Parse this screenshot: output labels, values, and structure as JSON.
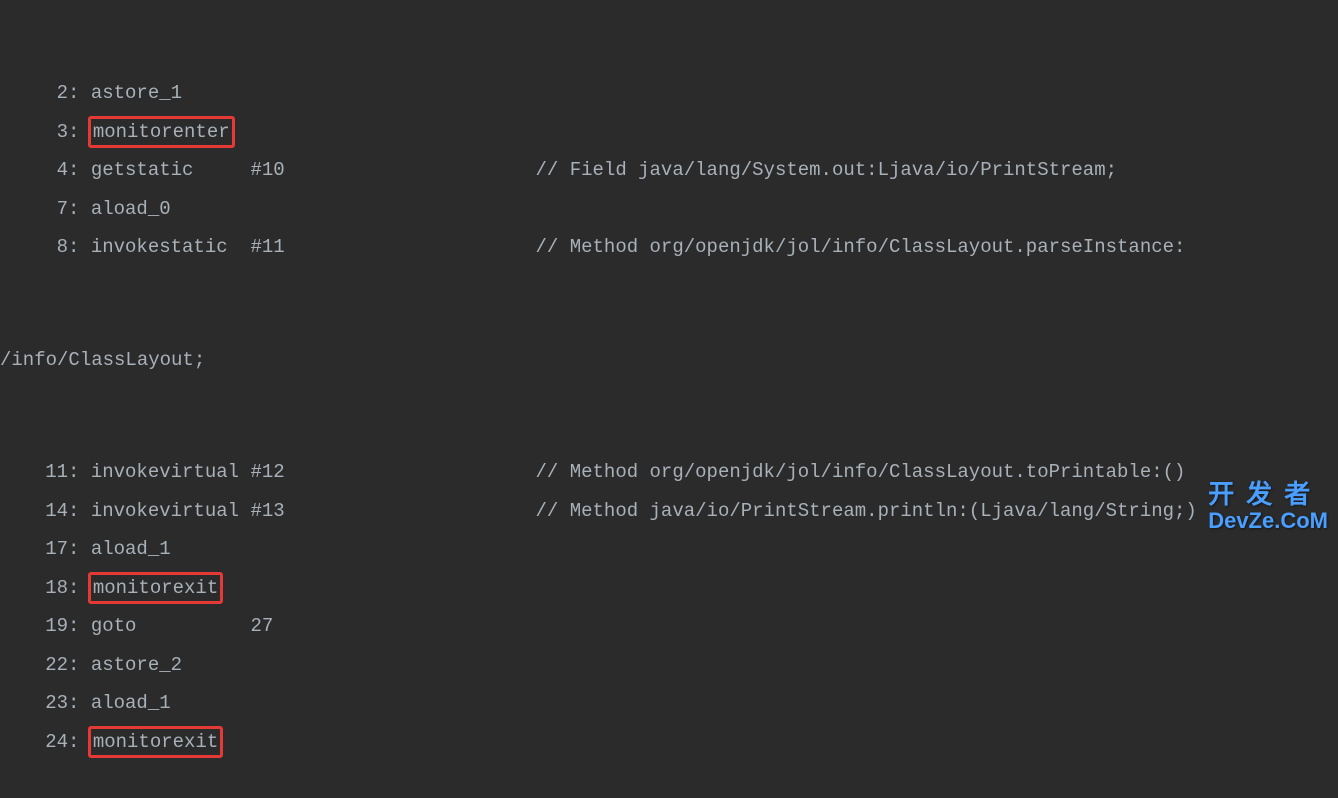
{
  "lines": [
    {
      "num": "2",
      "inst": "astore_1",
      "arg": "",
      "comment": "",
      "highlighted": false
    },
    {
      "num": "3",
      "inst": "monitorenter",
      "arg": "",
      "comment": "",
      "highlighted": true
    },
    {
      "num": "4",
      "inst": "getstatic",
      "arg": "#10",
      "comment": "// Field java/lang/System.out:Ljava/io/PrintStream;",
      "highlighted": false
    },
    {
      "num": "7",
      "inst": "aload_0",
      "arg": "",
      "comment": "",
      "highlighted": false
    },
    {
      "num": "8",
      "inst": "invokestatic",
      "arg": "#11",
      "comment": "// Method org/openjdk/jol/info/ClassLayout.parseInstance:",
      "highlighted": false
    }
  ],
  "continuation_line": "/info/ClassLayout;",
  "lines2": [
    {
      "num": "11",
      "inst": "invokevirtual",
      "arg": "#12",
      "comment": "// Method org/openjdk/jol/info/ClassLayout.toPrintable:()",
      "highlighted": false
    },
    {
      "num": "14",
      "inst": "invokevirtual",
      "arg": "#13",
      "comment": "// Method java/io/PrintStream.println:(Ljava/lang/String;)",
      "highlighted": false
    },
    {
      "num": "17",
      "inst": "aload_1",
      "arg": "",
      "comment": "",
      "highlighted": false
    },
    {
      "num": "18",
      "inst": "monitorexit",
      "arg": "",
      "comment": "",
      "highlighted": true
    },
    {
      "num": "19",
      "inst": "goto",
      "arg": "27",
      "comment": "",
      "highlighted": false
    },
    {
      "num": "22",
      "inst": "astore_2",
      "arg": "",
      "comment": "",
      "highlighted": false
    },
    {
      "num": "23",
      "inst": "aload_1",
      "arg": "",
      "comment": "",
      "highlighted": false
    },
    {
      "num": "24",
      "inst": "monitorexit",
      "arg": "",
      "comment": "",
      "highlighted": true
    }
  ],
  "watermark": {
    "cn": "开发者",
    "en": "DevZe.CoM"
  }
}
